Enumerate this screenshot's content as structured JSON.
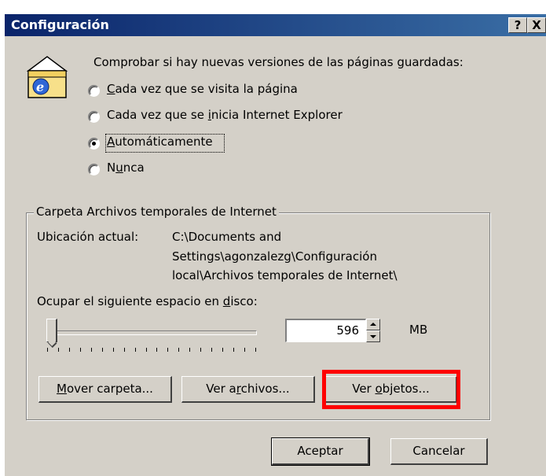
{
  "window": {
    "title": "Configuración",
    "help_button": "?",
    "close_button": "X"
  },
  "check_section": {
    "heading": "Comprobar si hay nuevas versiones de las páginas guardadas:",
    "options": [
      {
        "pre": "",
        "accel": "C",
        "post": "ada vez que se visita la página",
        "checked": false
      },
      {
        "pre": "Cada vez que se ",
        "accel": "i",
        "post": "nicia Internet Explorer",
        "checked": false
      },
      {
        "pre": "",
        "accel": "A",
        "post": "utomáticamente",
        "checked": true
      },
      {
        "pre": "N",
        "accel": "u",
        "post": "nca",
        "checked": false
      }
    ]
  },
  "temp_folder": {
    "group_label": "Carpeta Archivos temporales de Internet",
    "location_label": "Ubicación actual:",
    "location_lines": [
      "C:\\Documents and",
      "Settings\\agonzalezg\\Configuración",
      "local\\Archivos temporales de Internet\\"
    ],
    "space_label_pre": "Ocupar el siguiente espacio en ",
    "space_label_accel": "d",
    "space_label_post": "isco:",
    "slider_fraction": 0.02,
    "disk_value": "596",
    "unit": "MB"
  },
  "buttons": {
    "move": {
      "pre": "",
      "accel": "M",
      "post": "over carpeta..."
    },
    "files": {
      "pre": "Ver a",
      "accel": "r",
      "post": "chivos..."
    },
    "objects": {
      "pre": "Ver ",
      "accel": "o",
      "post": "bjetos..."
    },
    "ok": "Aceptar",
    "cancel": "Cancelar"
  },
  "colors": {
    "titlebar": "#0a246a",
    "face": "#d4d0c8",
    "highlight": "#ff0000"
  },
  "icons": [
    "folder-ie-icon",
    "radio-icon",
    "spin-up-icon",
    "spin-down-icon"
  ]
}
